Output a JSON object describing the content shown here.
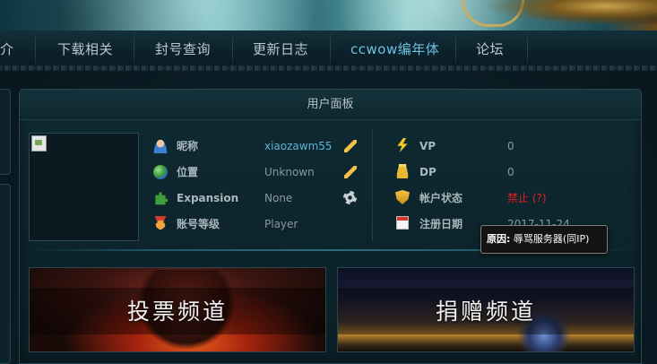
{
  "nav": {
    "items": [
      {
        "label": "介",
        "accent": false
      },
      {
        "label": "下载相关",
        "accent": false
      },
      {
        "label": "封号查询",
        "accent": false
      },
      {
        "label": "更新日志",
        "accent": false
      },
      {
        "label": "ccwow编年体",
        "accent": true
      },
      {
        "label": "论坛",
        "accent": false
      }
    ]
  },
  "panel": {
    "title": "用户面板",
    "left_rows": [
      {
        "icon": "user-icon",
        "label": "昵称",
        "value": "xiaozawm55",
        "action_icon": "pencil-icon"
      },
      {
        "icon": "globe-icon",
        "label": "位置",
        "value": "Unknown",
        "action_icon": "pencil-icon"
      },
      {
        "icon": "puzzle-icon",
        "label": "Expansion",
        "value": "None",
        "action_icon": "gear-icon"
      },
      {
        "icon": "medal-icon",
        "label": "账号等级",
        "value": "Player",
        "action_icon": ""
      }
    ],
    "right_rows": [
      {
        "icon": "bolt-icon",
        "label": "VP",
        "value": "0"
      },
      {
        "icon": "coins-icon",
        "label": "DP",
        "value": "0"
      },
      {
        "icon": "shield-icon",
        "label": "帐户状态",
        "value": "禁止 (?)"
      },
      {
        "icon": "calendar-icon",
        "label": "注册日期",
        "value": "2017-11-24"
      }
    ]
  },
  "tiles": {
    "vote": "投票频道",
    "donate": "捐赠频道"
  },
  "tooltip": {
    "label": "原因:",
    "text": "辱骂服务器(同IP)"
  },
  "colors": {
    "accent": "#6ec1e4",
    "link": "#5fb4d8",
    "banned": "#e0201c"
  }
}
